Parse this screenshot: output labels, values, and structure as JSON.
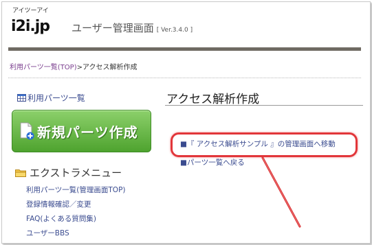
{
  "header": {
    "logo_kana": "アイツーアイ",
    "logo_text": "i2i.jp",
    "title": "ユーザー管理画面",
    "version": "[ Ver.3.4.0 ]"
  },
  "breadcrumb": {
    "link": "利用パーツ一覧(TOP)",
    "separator": ">",
    "current": "アクセス解析作成"
  },
  "sidebar": {
    "parts_list_label": "利用パーツ一覧",
    "new_parts_button": "新規パーツ作成",
    "extra_menu_title": "エクストラメニュー",
    "menu_items": [
      "利用パーツ一覧(管理画面TOP)",
      "登録情報確認／変更",
      "FAQ(よくある質問集)",
      "ユーザーBBS"
    ]
  },
  "main": {
    "title": "アクセス解析作成",
    "link_manage": "■『 アクセス解析サンプル 』の管理画面へ移動",
    "link_back": "■パーツ一覧へ戻る"
  },
  "colors": {
    "highlight": "#e2363a",
    "button_green": "#4ea32f",
    "link_blue": "#3a4b8f"
  }
}
